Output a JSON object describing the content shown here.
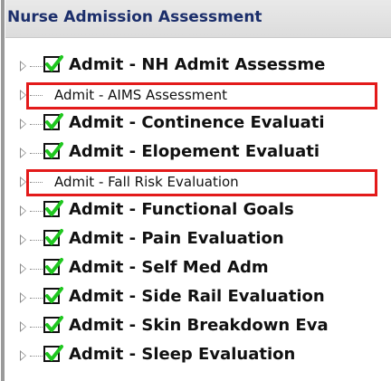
{
  "header": {
    "title": "Nurse Admission Assessment"
  },
  "tree": {
    "items": [
      {
        "label": "Admit - NH Admit Assessme",
        "checked": true,
        "style": "bold"
      },
      {
        "label": "Admit - AIMS Assessment",
        "checked": false,
        "style": "plain",
        "highlighted": true
      },
      {
        "label": "Admit - Continence Evaluati",
        "checked": true,
        "style": "bold"
      },
      {
        "label": "Admit - Elopement Evaluati",
        "checked": true,
        "style": "bold"
      },
      {
        "label": "Admit - Fall Risk Evaluation",
        "checked": false,
        "style": "plain",
        "highlighted": true
      },
      {
        "label": "Admit - Functional Goals",
        "checked": true,
        "style": "bold"
      },
      {
        "label": "Admit - Pain Evaluation",
        "checked": true,
        "style": "bold"
      },
      {
        "label": "Admit - Self Med Adm",
        "checked": true,
        "style": "bold"
      },
      {
        "label": "Admit - Side Rail Evaluation",
        "checked": true,
        "style": "bold"
      },
      {
        "label": "Admit - Skin Breakdown Eva",
        "checked": true,
        "style": "bold"
      },
      {
        "label": "Admit - Sleep Evaluation",
        "checked": true,
        "style": "bold"
      }
    ]
  },
  "colors": {
    "header_text": "#1b2e6b",
    "highlight_border": "#e31a1a",
    "check_green": "#1fc71f"
  },
  "icons": {
    "expander": "triangle-right-icon",
    "check": "green-checkmark-icon"
  }
}
